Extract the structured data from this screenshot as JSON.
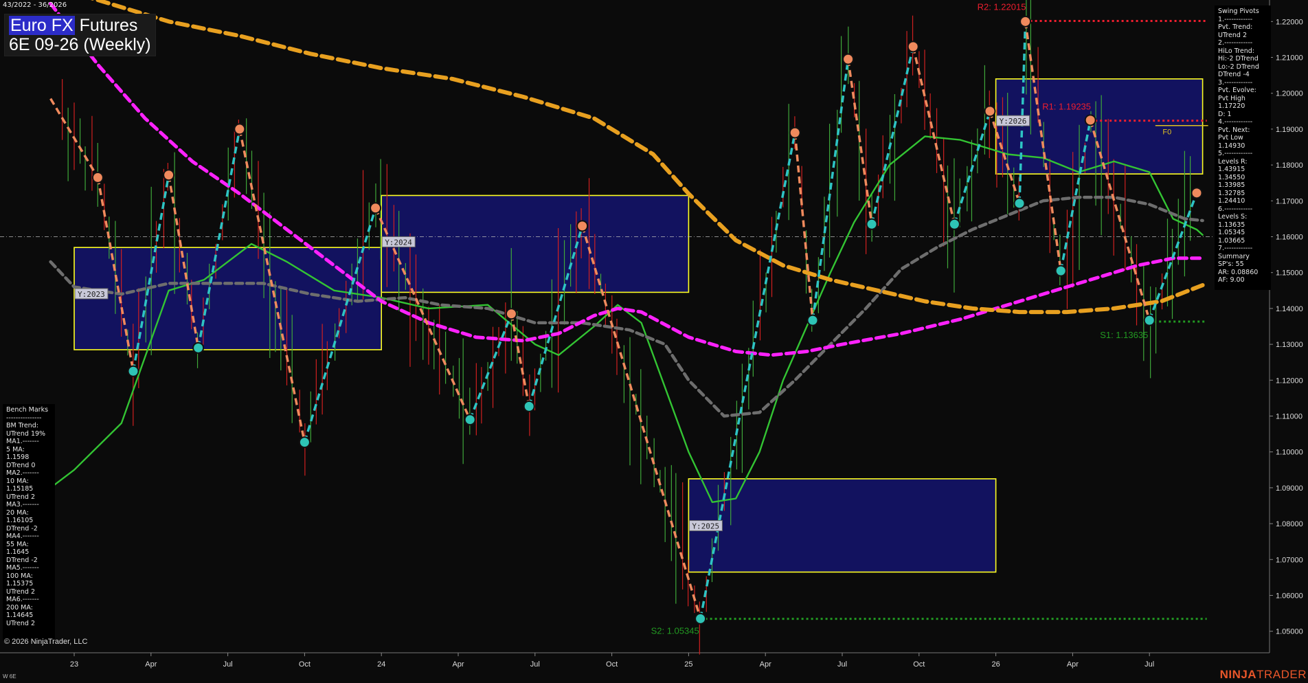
{
  "header": {
    "date_range": "43/2022 - 36/2026",
    "instrument": "Euro FX Futures",
    "instrument_highlight": "Euro FX",
    "instrument_rest": " Futures",
    "contract": "6E 09-26 (Weekly)"
  },
  "footer": {
    "copyright": "© 2026 NinjaTrader, LLC",
    "status": "W 6E",
    "brand_bold": "NINJA",
    "brand_thin": "TRADER"
  },
  "swing_panel": {
    "lines": [
      "Swing Pivots",
      "1.------------",
      "Pvt. Trend:",
      "UTrend 2",
      "2.------------",
      "HiLo Trend:",
      "Hi:-2 DTrend",
      "Lo:-2 DTrend",
      "DTrend -4",
      "3.------------",
      "Pvt. Evolve:",
      "Pvt High",
      "1.17220",
      "D: 1",
      "4.------------",
      "Pvt. Next:",
      "Pvt Low",
      "1.14930",
      "5.------------",
      "Levels R:",
      "1.43915",
      "1.34550",
      "1.33985",
      "1.32785",
      "1.24410",
      "6.------------",
      "Levels S:",
      "1.13635",
      "1.05345",
      "1.03665",
      "7.------------",
      "Summary",
      "SP's: 55",
      "AR: 0.08860",
      "AF: 9.00"
    ]
  },
  "bench_panel": {
    "lines": [
      "Bench Marks",
      "---------------",
      "BM Trend:",
      "UTrend 19%",
      "MA1.-------",
      "5 MA:",
      "1.1598",
      "DTrend 0",
      "MA2.-------",
      "10 MA:",
      "1.15185",
      "UTrend 2",
      "MA3.-------",
      "20 MA:",
      "1.16105",
      "DTrend -2",
      "MA4.-------",
      "55 MA:",
      "1.1645",
      "DTrend -2",
      "MA5.-------",
      "100 MA:",
      "1.15375",
      "UTrend 2",
      "MA6.-------",
      "200 MA:",
      "1.14645",
      "UTrend 2"
    ]
  },
  "colors": {
    "background": "#0b0b0b",
    "up_bar": "#3fa83a",
    "down_bar": "#d02020",
    "swing_up": "#2ec4c4",
    "swing_down": "#f08a5d",
    "pivot_high": "#f08a5d",
    "pivot_low": "#2ec4b6",
    "ma_green": "#33c433",
    "ma_gray": "#6e6e6e",
    "ma_magenta": "#ff22ff",
    "ma_orange": "#e8a020",
    "year_box_fill": "#14146e",
    "year_box_border": "#ffff22",
    "resistance": "#ee1e2e",
    "support": "#229922"
  },
  "chart_data": {
    "type": "line",
    "title": "Euro FX Futures 6E 09-26 (Weekly)",
    "y_axis": {
      "ylim": [
        1.044,
        1.226
      ],
      "ticks": [
        "1.05000",
        "1.06000",
        "1.07000",
        "1.08000",
        "1.09000",
        "1.10000",
        "1.11000",
        "1.12000",
        "1.13000",
        "1.14000",
        "1.15000",
        "1.16000",
        "1.17000",
        "1.18000",
        "1.19000",
        "1.20000",
        "1.21000",
        "1.22000"
      ]
    },
    "x_axis": {
      "ticks": [
        "23",
        "Apr",
        "Jul",
        "Oct",
        "24",
        "Apr",
        "Jul",
        "Oct",
        "25",
        "Apr",
        "Jul",
        "Oct",
        "26",
        "Apr",
        "Jul"
      ],
      "tick_weeks": [
        0,
        13,
        26,
        39,
        52,
        65,
        78,
        91,
        104,
        117,
        130,
        143,
        156,
        169,
        182
      ]
    },
    "reference_line": 1.16,
    "swing_pivots": [
      {
        "w": -4,
        "v": 1.1985,
        "type": "H"
      },
      {
        "w": 4,
        "v": 1.1765,
        "type": "H"
      },
      {
        "w": 10,
        "v": 1.1225,
        "type": "L"
      },
      {
        "w": 16,
        "v": 1.1772,
        "type": "H"
      },
      {
        "w": 21,
        "v": 1.129,
        "type": "L"
      },
      {
        "w": 28,
        "v": 1.19,
        "type": "H"
      },
      {
        "w": 39,
        "v": 1.1027,
        "type": "L"
      },
      {
        "w": 51,
        "v": 1.168,
        "type": "H"
      },
      {
        "w": 67,
        "v": 1.109,
        "type": "L"
      },
      {
        "w": 74,
        "v": 1.1385,
        "type": "H"
      },
      {
        "w": 77,
        "v": 1.1127,
        "type": "L"
      },
      {
        "w": 86,
        "v": 1.163,
        "type": "H"
      },
      {
        "w": 106,
        "v": 1.0535,
        "type": "L"
      },
      {
        "w": 122,
        "v": 1.189,
        "type": "H"
      },
      {
        "w": 125,
        "v": 1.1367,
        "type": "L"
      },
      {
        "w": 131,
        "v": 1.2095,
        "type": "H"
      },
      {
        "w": 135,
        "v": 1.1635,
        "type": "L"
      },
      {
        "w": 142,
        "v": 1.213,
        "type": "H"
      },
      {
        "w": 149,
        "v": 1.1635,
        "type": "L"
      },
      {
        "w": 155,
        "v": 1.195,
        "type": "H"
      },
      {
        "w": 160,
        "v": 1.1693,
        "type": "L"
      },
      {
        "w": 161,
        "v": 1.22,
        "type": "H"
      },
      {
        "w": 167,
        "v": 1.1505,
        "type": "L"
      },
      {
        "w": 172,
        "v": 1.1925,
        "type": "H"
      },
      {
        "w": 182,
        "v": 1.1367,
        "type": "L"
      },
      {
        "w": 190,
        "v": 1.1722,
        "type": "H"
      }
    ],
    "year_boxes": [
      {
        "label": "Y:2023",
        "x0": 0,
        "x1": 52,
        "y_high": 1.157,
        "y_low": 1.1285
      },
      {
        "label": "Y:2024",
        "x0": 52,
        "x1": 104,
        "y_high": 1.1715,
        "y_low": 1.1445
      },
      {
        "label": "Y:2025",
        "x0": 104,
        "x1": 156,
        "y_high": 1.0925,
        "y_low": 1.0665
      },
      {
        "label": "Y:2026",
        "x0": 156,
        "x1": 191,
        "y_high": 1.204,
        "y_low": 1.1775
      }
    ],
    "levels": [
      {
        "label": "R2: 1.22015",
        "value": 1.22015,
        "w_start": 161,
        "kind": "R"
      },
      {
        "label": "R1: 1.19235",
        "value": 1.19235,
        "w_start": 172,
        "kind": "R"
      },
      {
        "label": "S1: 1.13635",
        "value": 1.13635,
        "w_start": 182,
        "kind": "S"
      },
      {
        "label": "S2: 1.05345",
        "value": 1.05345,
        "w_start": 106,
        "kind": "S"
      }
    ],
    "f0_label": "F0",
    "f0_value": 1.191,
    "moving_averages": [
      {
        "name": "20 MA",
        "color": "green",
        "points": [
          [
            -4,
            1.09
          ],
          [
            0,
            1.095
          ],
          [
            8,
            1.108
          ],
          [
            16,
            1.145
          ],
          [
            22,
            1.148
          ],
          [
            30,
            1.158
          ],
          [
            36,
            1.153
          ],
          [
            44,
            1.145
          ],
          [
            52,
            1.143
          ],
          [
            60,
            1.14
          ],
          [
            70,
            1.141
          ],
          [
            78,
            1.13
          ],
          [
            82,
            1.127
          ],
          [
            88,
            1.135
          ],
          [
            92,
            1.141
          ],
          [
            96,
            1.136
          ],
          [
            100,
            1.118
          ],
          [
            104,
            1.1
          ],
          [
            108,
            1.086
          ],
          [
            112,
            1.087
          ],
          [
            116,
            1.1
          ],
          [
            120,
            1.12
          ],
          [
            124,
            1.135
          ],
          [
            128,
            1.15
          ],
          [
            132,
            1.164
          ],
          [
            138,
            1.18
          ],
          [
            144,
            1.188
          ],
          [
            150,
            1.187
          ],
          [
            154,
            1.185
          ],
          [
            158,
            1.183
          ],
          [
            164,
            1.182
          ],
          [
            170,
            1.178
          ],
          [
            176,
            1.181
          ],
          [
            182,
            1.178
          ],
          [
            186,
            1.165
          ],
          [
            190,
            1.162
          ],
          [
            191,
            1.1605
          ]
        ]
      },
      {
        "name": "55 MA",
        "color": "gray",
        "points": [
          [
            -4,
            1.153
          ],
          [
            0,
            1.146
          ],
          [
            8,
            1.144
          ],
          [
            16,
            1.147
          ],
          [
            24,
            1.147
          ],
          [
            32,
            1.147
          ],
          [
            40,
            1.144
          ],
          [
            48,
            1.142
          ],
          [
            56,
            1.143
          ],
          [
            62,
            1.141
          ],
          [
            70,
            1.14
          ],
          [
            78,
            1.136
          ],
          [
            86,
            1.136
          ],
          [
            94,
            1.134
          ],
          [
            100,
            1.13
          ],
          [
            104,
            1.12
          ],
          [
            110,
            1.11
          ],
          [
            116,
            1.111
          ],
          [
            122,
            1.12
          ],
          [
            128,
            1.13
          ],
          [
            134,
            1.14
          ],
          [
            140,
            1.151
          ],
          [
            146,
            1.157
          ],
          [
            152,
            1.162
          ],
          [
            158,
            1.166
          ],
          [
            164,
            1.17
          ],
          [
            170,
            1.171
          ],
          [
            176,
            1.171
          ],
          [
            182,
            1.169
          ],
          [
            188,
            1.165
          ],
          [
            191,
            1.1645
          ]
        ]
      },
      {
        "name": "100 MA",
        "color": "magenta",
        "points": [
          [
            -4,
            1.225
          ],
          [
            4,
            1.208
          ],
          [
            12,
            1.193
          ],
          [
            20,
            1.181
          ],
          [
            28,
            1.172
          ],
          [
            36,
            1.162
          ],
          [
            44,
            1.152
          ],
          [
            52,
            1.142
          ],
          [
            60,
            1.136
          ],
          [
            68,
            1.132
          ],
          [
            76,
            1.131
          ],
          [
            82,
            1.133
          ],
          [
            88,
            1.138
          ],
          [
            92,
            1.14
          ],
          [
            96,
            1.139
          ],
          [
            104,
            1.132
          ],
          [
            112,
            1.128
          ],
          [
            118,
            1.127
          ],
          [
            124,
            1.128
          ],
          [
            130,
            1.13
          ],
          [
            140,
            1.133
          ],
          [
            150,
            1.137
          ],
          [
            160,
            1.142
          ],
          [
            170,
            1.147
          ],
          [
            180,
            1.152
          ],
          [
            186,
            1.154
          ],
          [
            191,
            1.154
          ]
        ]
      },
      {
        "name": "200 MA",
        "color": "orange",
        "points": [
          [
            -4,
            1.23
          ],
          [
            4,
            1.226
          ],
          [
            16,
            1.22
          ],
          [
            28,
            1.216
          ],
          [
            40,
            1.211
          ],
          [
            52,
            1.207
          ],
          [
            64,
            1.204
          ],
          [
            76,
            1.199
          ],
          [
            88,
            1.193
          ],
          [
            98,
            1.183
          ],
          [
            104,
            1.172
          ],
          [
            112,
            1.159
          ],
          [
            120,
            1.152
          ],
          [
            128,
            1.148
          ],
          [
            136,
            1.145
          ],
          [
            144,
            1.142
          ],
          [
            152,
            1.14
          ],
          [
            160,
            1.139
          ],
          [
            168,
            1.139
          ],
          [
            176,
            1.14
          ],
          [
            184,
            1.142
          ],
          [
            191,
            1.1465
          ]
        ]
      }
    ]
  }
}
